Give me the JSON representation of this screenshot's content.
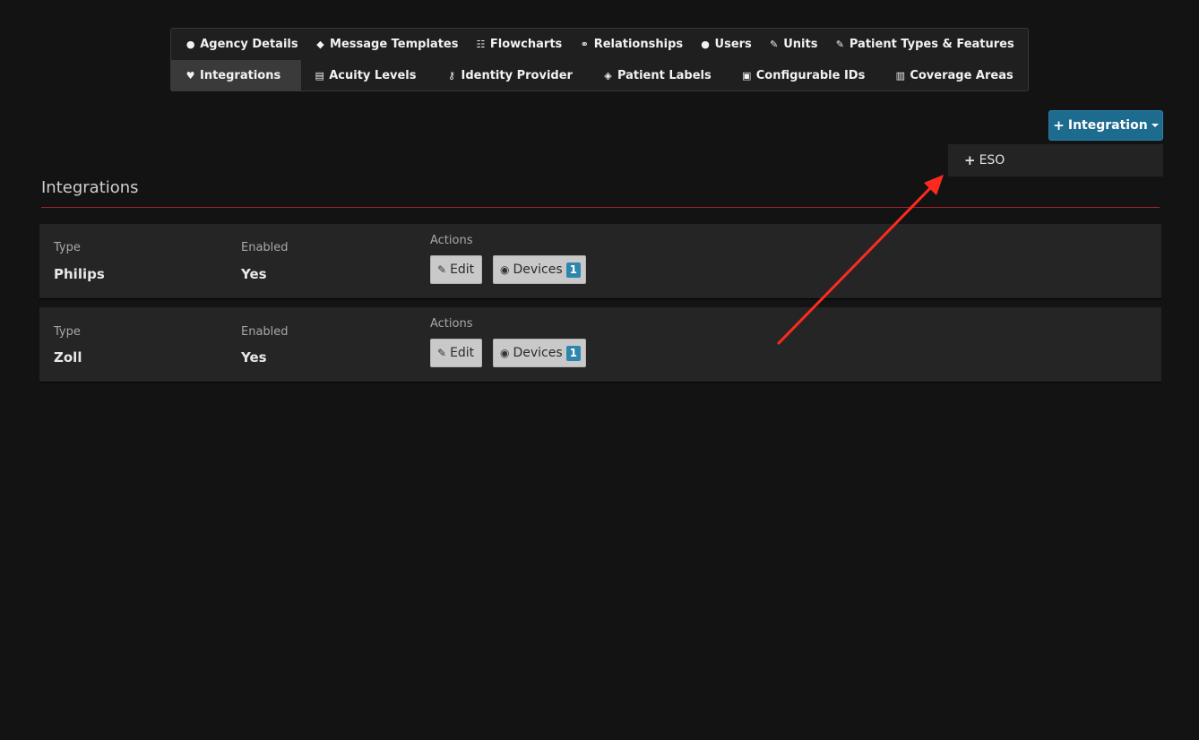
{
  "tabs": {
    "row1": [
      {
        "label": "Agency Details",
        "icon": "info-circle-icon",
        "glyph": "●"
      },
      {
        "label": "Message Templates",
        "icon": "comments-icon",
        "glyph": "◆"
      },
      {
        "label": "Flowcharts",
        "icon": "list-icon",
        "glyph": "☷"
      },
      {
        "label": "Relationships",
        "icon": "handshake-icon",
        "glyph": "⚭"
      },
      {
        "label": "Users",
        "icon": "user-icon",
        "glyph": "●"
      },
      {
        "label": "Units",
        "icon": "pencil-icon",
        "glyph": "✎"
      },
      {
        "label": "Patient Types & Features",
        "icon": "pencil-icon",
        "glyph": "✎"
      }
    ],
    "row2": [
      {
        "label": "Integrations",
        "icon": "heartbeat-icon",
        "glyph": "♥",
        "active": true
      },
      {
        "label": "Acuity Levels",
        "icon": "copy-icon",
        "glyph": "▤"
      },
      {
        "label": "Identity Provider",
        "icon": "key-icon",
        "glyph": "⚷"
      },
      {
        "label": "Patient Labels",
        "icon": "tags-icon",
        "glyph": "◈"
      },
      {
        "label": "Configurable IDs",
        "icon": "id-badge-icon",
        "glyph": "▣"
      },
      {
        "label": "Coverage Areas",
        "icon": "map-icon",
        "glyph": "▥"
      }
    ]
  },
  "add_button": {
    "plus": "+",
    "label": "Integration"
  },
  "dropdown": {
    "items": [
      {
        "plus": "+",
        "label": "ESO"
      }
    ]
  },
  "section": {
    "title": "Integrations"
  },
  "columns": {
    "type": "Type",
    "enabled": "Enabled",
    "actions": "Actions"
  },
  "rows": [
    {
      "type": "Philips",
      "enabled": "Yes",
      "edit_label": "Edit",
      "devices_label": "Devices",
      "devices_count": "1"
    },
    {
      "type": "Zoll",
      "enabled": "Yes",
      "edit_label": "Edit",
      "devices_label": "Devices",
      "devices_count": "1"
    }
  ],
  "colors": {
    "accent": "#1d6b8f",
    "rule": "#a3222a",
    "badge": "#2e86ad",
    "annotation_arrow": "#ff2a1f"
  }
}
